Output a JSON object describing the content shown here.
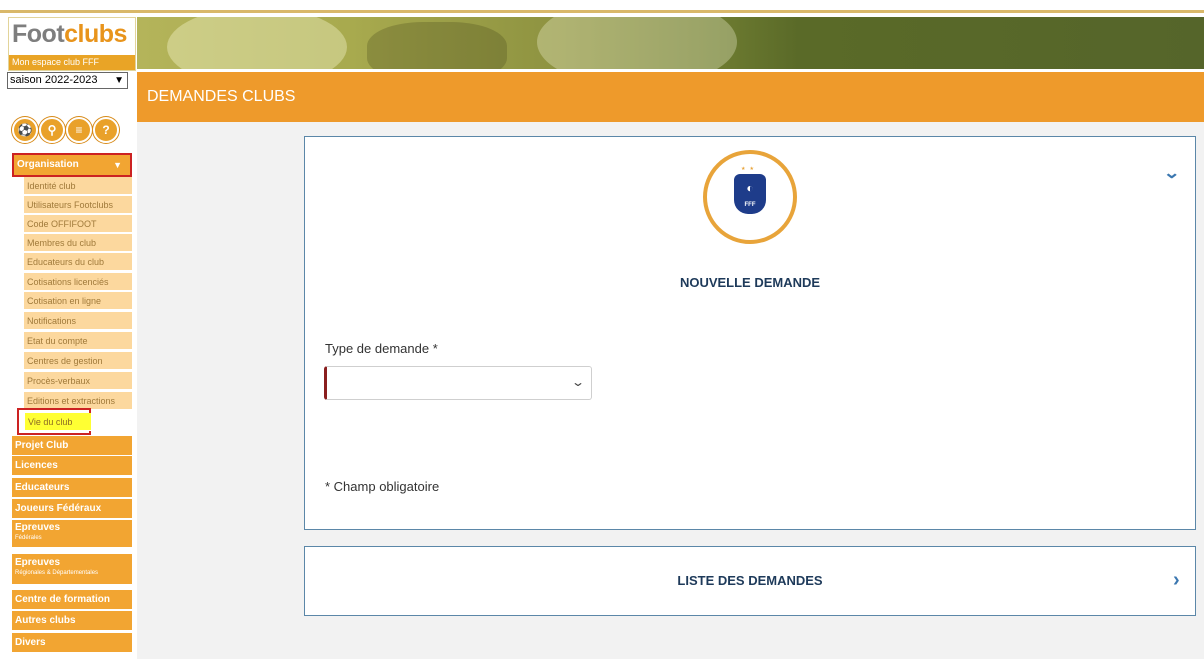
{
  "logo": {
    "word_a": "Foot",
    "word_b": "clubs",
    "tagline": "Mon espace club FFF"
  },
  "season": {
    "selected": "saison 2022-2023"
  },
  "page": {
    "title": "DEMANDES CLUBS"
  },
  "toolbar_icons": [
    "ball-icon",
    "search-icon",
    "document-icon",
    "help-icon"
  ],
  "sidebar": {
    "organisation": "Organisation",
    "sub_items": [
      "Identité club",
      "Utilisateurs Footclubs",
      "Code OFFIFOOT",
      "Membres du club",
      "Educateurs du club",
      "Cotisations licenciés",
      "Cotisation en ligne",
      "Notifications",
      "Etat du compte",
      "Centres de gestion",
      "Procès-verbaux",
      "Editions et extractions"
    ],
    "vie_du_club": "Vie du club",
    "groups": [
      {
        "label": "Projet Club",
        "sub": ""
      },
      {
        "label": "Licences",
        "sub": ""
      },
      {
        "label": "Educateurs",
        "sub": ""
      },
      {
        "label": "Joueurs Fédéraux",
        "sub": ""
      },
      {
        "label": "Epreuves",
        "sub": "Fédérales"
      },
      {
        "label": "Epreuves",
        "sub": "Régionales & Départementales"
      },
      {
        "label": "Centre de formation",
        "sub": ""
      },
      {
        "label": "Autres clubs",
        "sub": ""
      },
      {
        "label": "Divers",
        "sub": ""
      }
    ]
  },
  "form": {
    "heading": "NOUVELLE DEMANDE",
    "type_label": "Type de demande *",
    "type_value": "",
    "required_note": "* Champ obligatoire",
    "badge_text": "FFF"
  },
  "list": {
    "heading": "LISTE DES DEMANDES"
  }
}
